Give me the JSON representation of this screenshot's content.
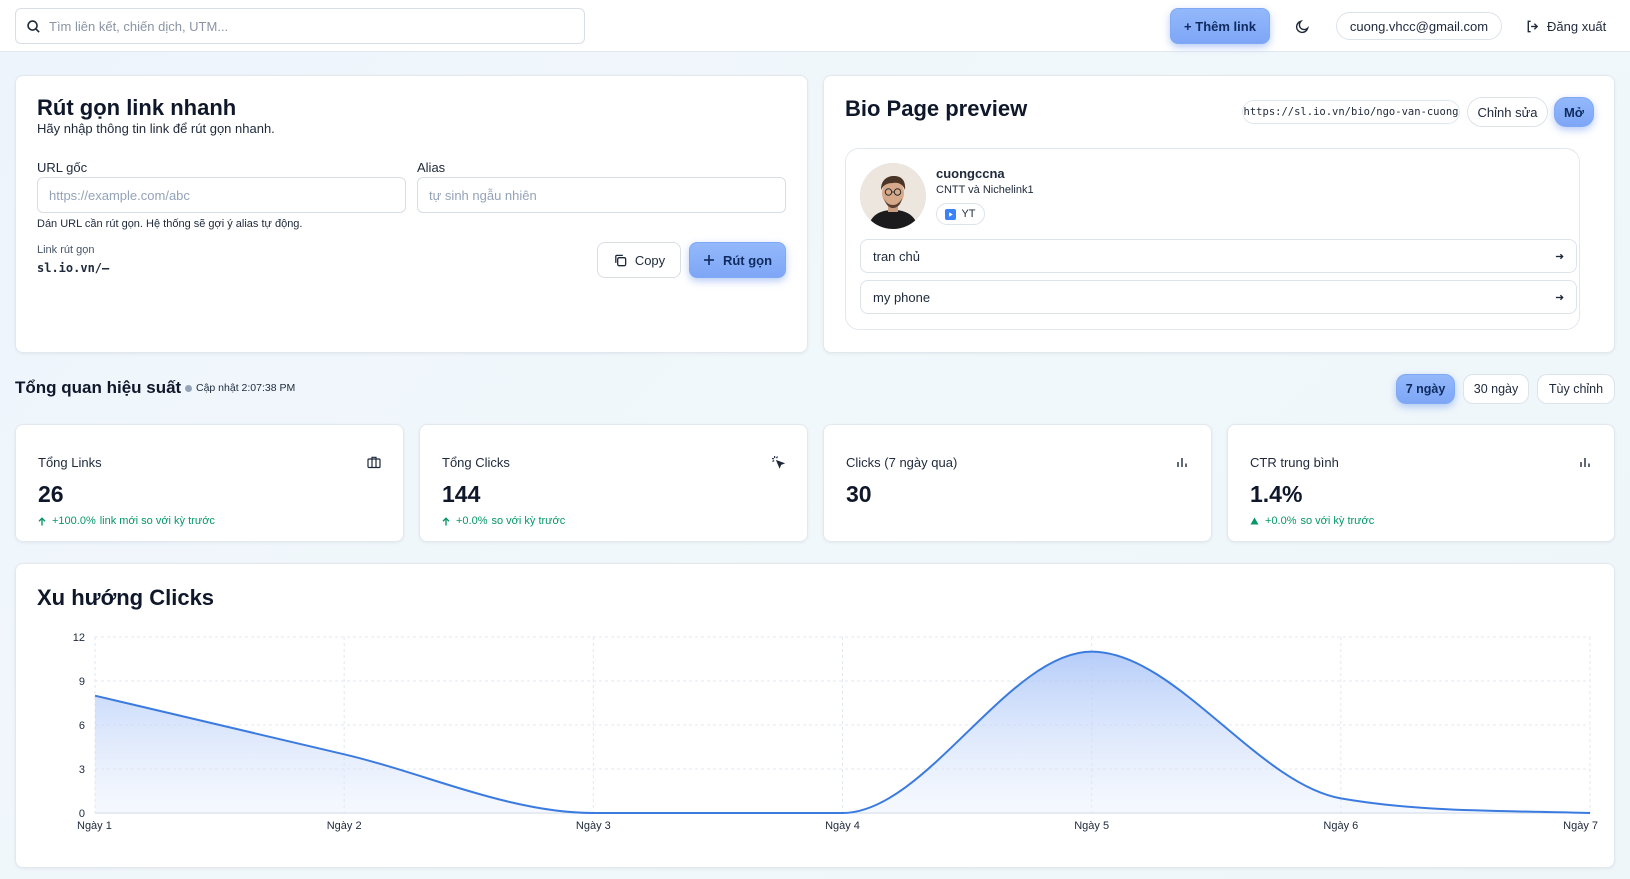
{
  "topbar": {
    "search_placeholder": "Tìm liên kết, chiến dịch, UTM...",
    "add_link_label": "+ Thêm link",
    "user_email": "cuong.vhcc@gmail.com",
    "logout_label": "Đăng xuất"
  },
  "shortener": {
    "title": "Rút gọn link nhanh",
    "subtitle": "Hãy nhập thông tin link để rút gọn nhanh.",
    "url_label": "URL gốc",
    "url_placeholder": "https://example.com/abc",
    "alias_label": "Alias",
    "alias_placeholder": "tự sinh ngẫu nhiên",
    "hint": "Dán URL cần rút gọn. Hệ thống sẽ gợi ý alias tự động.",
    "result_label": "Link rút gọn",
    "result_value": "sl.io.vn/—",
    "copy_label": "Copy",
    "shorten_label": "Rút gọn"
  },
  "bio": {
    "title": "Bio Page preview",
    "url": "https://sl.io.vn/bio/ngo-van-cuong",
    "edit_label": "Chỉnh sửa",
    "open_label": "Mở",
    "name": "cuongccna",
    "description": "CNTT và Nichelink1",
    "social_chip": "YT",
    "links": [
      {
        "label": "tran chủ"
      },
      {
        "label": "my phone"
      }
    ]
  },
  "overview": {
    "title": "Tổng quan hiệu suất",
    "updated": "Cập nhật 2:07:38 PM",
    "ranges": [
      "7 ngày",
      "30 ngày",
      "Tùy chỉnh"
    ],
    "active_range": "7 ngày"
  },
  "stats": [
    {
      "title": "Tổng Links",
      "value": "26",
      "delta": "+100.0%",
      "delta_text": "link mới so với kỳ trước",
      "icon": "briefcase-icon"
    },
    {
      "title": "Tổng Clicks",
      "value": "144",
      "delta": "+0.0%",
      "delta_text": "so với kỳ trước",
      "icon": "mouse-pointer-click-icon"
    },
    {
      "title": "Clicks (7 ngày qua)",
      "value": "30",
      "icon": "bar-chart-icon"
    },
    {
      "title": "CTR trung bình",
      "value": "1.4%",
      "delta": "+0.0%",
      "delta_text": "so với kỳ trước",
      "icon": "bar-chart-icon"
    }
  ],
  "colors": {
    "accent": "#7ea6f6",
    "line": "#3b7be0",
    "positive": "#059669"
  },
  "chart_data": {
    "type": "area",
    "title": "Xu hướng Clicks",
    "categories": [
      "Ngày 1",
      "Ngày 2",
      "Ngày 3",
      "Ngày 4",
      "Ngày 5",
      "Ngày 6",
      "Ngày 7"
    ],
    "series": [
      {
        "values": [
          8,
          4,
          0,
          0,
          11,
          1,
          0
        ]
      }
    ],
    "ylim": [
      0,
      12
    ],
    "yticks": [
      0,
      3,
      6,
      9,
      12
    ],
    "grid": true,
    "legend": "none"
  }
}
